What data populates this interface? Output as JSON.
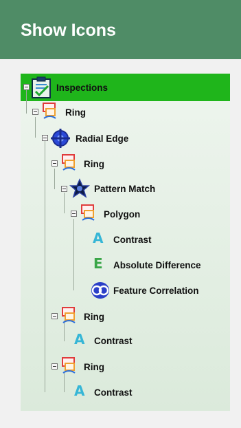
{
  "header": {
    "title": "Show Icons"
  },
  "tree": {
    "root": {
      "label": "Inspections",
      "icon": "clipboard-check-icon"
    },
    "nodes": [
      {
        "label": "Ring",
        "icon": "ring-tool-icon"
      },
      {
        "label": "Radial Edge",
        "icon": "radial-edge-icon"
      },
      {
        "label": "Ring",
        "icon": "ring-tool-icon"
      },
      {
        "label": "Pattern Match",
        "icon": "pattern-match-icon"
      },
      {
        "label": "Polygon",
        "icon": "polygon-tool-icon"
      },
      {
        "label": "Contrast",
        "icon": "letter-a-icon",
        "glyph": "A"
      },
      {
        "label": "Absolute Difference",
        "icon": "letter-e-icon",
        "glyph": "E"
      },
      {
        "label": "Feature Correlation",
        "icon": "feature-correlation-icon"
      },
      {
        "label": "Ring",
        "icon": "ring-tool-icon"
      },
      {
        "label": "Contrast",
        "icon": "letter-a-icon",
        "glyph": "A"
      },
      {
        "label": "Ring",
        "icon": "ring-tool-icon"
      },
      {
        "label": "Contrast",
        "icon": "letter-a-icon",
        "glyph": "A"
      }
    ]
  },
  "colors": {
    "header_bg": "#4f8c66",
    "root_bg": "#1fb51b",
    "letter_a": "#36b6d6",
    "letter_e": "#3aa648"
  }
}
